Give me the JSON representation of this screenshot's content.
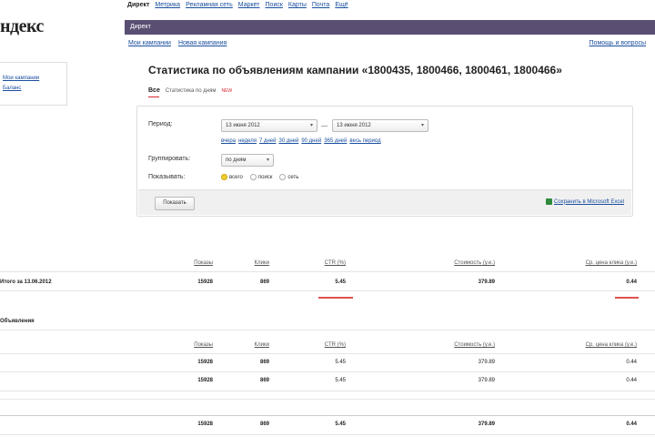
{
  "logo": "ндекс",
  "topnav": [
    "Директ",
    "Метрика",
    "Рекламная сеть",
    "Маркет",
    "Поиск",
    "Карты",
    "Почта",
    "Ещё"
  ],
  "purplebar": {
    "title": "Директ"
  },
  "subtabs": [
    "Мои кампании",
    "Новая кампания"
  ],
  "help_link": "Помощь и вопросы",
  "sidebar": {
    "links": [
      "Мои кампании",
      "Баланс"
    ]
  },
  "page_title": "Статистика по объявлениям кампании «1800435, 1800466, 1800461, 1800466»",
  "filter": {
    "label": "Все",
    "link": "Статистика по дням",
    "badge": "NEW"
  },
  "panel": {
    "period_label": "Период:",
    "date_from": "13 июня 2012",
    "date_to": "13 июня 2012",
    "quick_links": [
      "вчера",
      "неделя",
      "7 дней",
      "30 дней",
      "90 дней",
      "365 дней",
      "весь период"
    ],
    "group_label": "Группировать:",
    "group_value": "по дням",
    "show_label": "Показывать:",
    "radios": [
      {
        "label": "всего",
        "selected": true
      },
      {
        "label": "поиск",
        "selected": false
      },
      {
        "label": "сеть",
        "selected": false
      }
    ],
    "show_button": "Показать",
    "export_link": "Сохранить в Microsoft Excel"
  },
  "table1": {
    "headers": [
      "Показы",
      "Клики",
      "CTR (%)",
      "Стоимость (у.е.)",
      "Ср. цена клика (у.е.)"
    ],
    "row": {
      "name": "Итого за 13.06.2012",
      "values": [
        "15928",
        "869",
        "5.45",
        "379.89",
        "0.44"
      ]
    }
  },
  "section": {
    "title": "Объявления"
  },
  "table2": {
    "headers": [
      "Показы",
      "Клики",
      "CTR (%)",
      "Стоимость (у.е.)",
      "Ср. цена клика (у.е.)"
    ],
    "rows": [
      {
        "values": [
          "15928",
          "869",
          "5.45",
          "379.89",
          "0.44"
        ]
      },
      {
        "values": [
          "15928",
          "869",
          "5.45",
          "379.89",
          "0.44"
        ]
      }
    ],
    "total": {
      "values": [
        "15928",
        "869",
        "5.45",
        "379.89",
        "0.44"
      ]
    }
  },
  "colors": {
    "accent_bar": "#5a4e73",
    "link": "#1a4fa0",
    "negative": "#e05050",
    "radio_selected": "#f3cf31"
  }
}
